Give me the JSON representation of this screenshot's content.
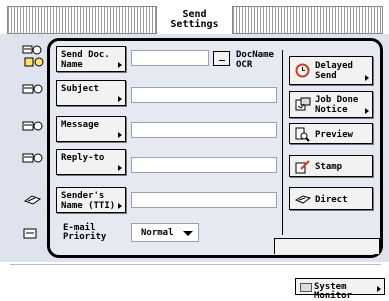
{
  "header": {
    "title_line1": "Send",
    "title_line2": "Settings"
  },
  "left_icons": [
    {
      "name": "address-book-icon"
    },
    {
      "name": "subject-icon"
    },
    {
      "name": "message-icon"
    },
    {
      "name": "reply-to-icon"
    },
    {
      "name": "sender-name-icon"
    },
    {
      "name": "priority-icon"
    }
  ],
  "fields": {
    "send_doc_name": {
      "label_line1": "Send Doc.",
      "label_line2": "Name",
      "value": ""
    },
    "subject": {
      "label": "Subject",
      "value": ""
    },
    "message": {
      "label": "Message",
      "value": ""
    },
    "reply_to": {
      "label": "Reply-to",
      "value": ""
    },
    "sender_name": {
      "label_line1": "Sender's",
      "label_line2": "Name (TTI)",
      "value": ""
    }
  },
  "docname_ocr": {
    "line1": "DocName",
    "line2": "OCR"
  },
  "email_priority": {
    "label_line1": "E-mail",
    "label_line2": "Priority",
    "selected": "Normal"
  },
  "right_buttons": {
    "delayed_send": {
      "line1": "Delayed",
      "line2": "Send"
    },
    "job_done_notice": {
      "line1": "Job Done",
      "line2": "Notice"
    },
    "preview": "Preview",
    "stamp": "Stamp",
    "direct": "Direct"
  },
  "footer": {
    "system_monitor": "System Monitor"
  },
  "colors": {
    "frame": "#000000",
    "panel": "#e6e9f2",
    "field": "#ffffff",
    "accent_red": "#d23a2a"
  }
}
